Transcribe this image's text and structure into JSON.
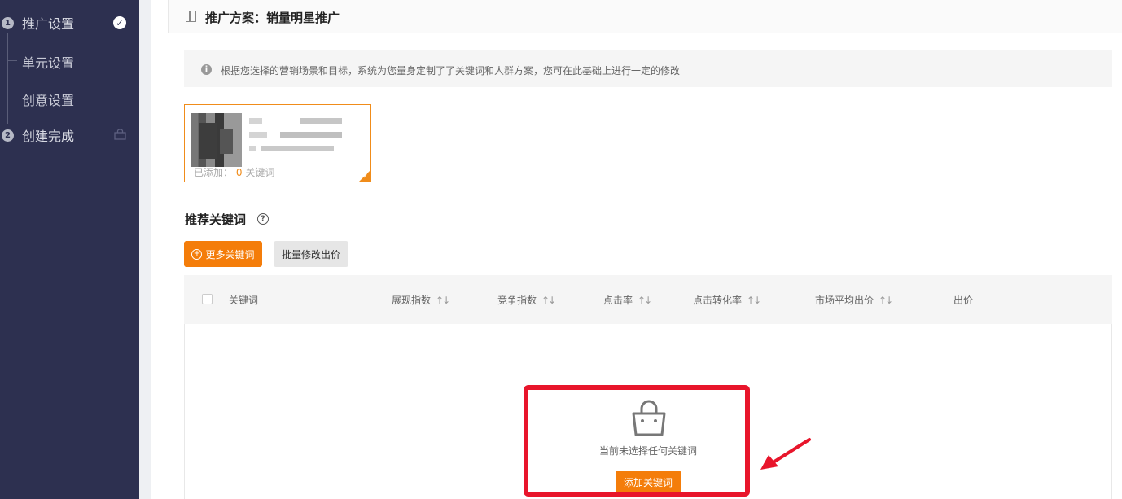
{
  "sidebar": {
    "steps": [
      {
        "num": "1",
        "label": "推广设置"
      },
      {
        "num": "2",
        "label": "创建完成"
      }
    ],
    "sub_items": [
      {
        "label": "单元设置"
      },
      {
        "label": "创意设置"
      }
    ],
    "check_mark": "✓"
  },
  "header": {
    "title": "推广方案：销量明星推广"
  },
  "info": {
    "icon": "i",
    "text": "根据您选择的营销场景和目标，系统为您量身定制了了关键词和人群方案，您可在此基础上进行一定的修改"
  },
  "plan_card": {
    "added_prefix": "已添加：",
    "added_count": "0",
    "added_suffix": "关键词"
  },
  "keywords_section": {
    "title": "推荐关键词",
    "help_icon": "?",
    "more_button": "更多关键词",
    "more_button_icon": "+",
    "batch_button": "批量修改出价"
  },
  "table": {
    "sort_glyph": "↑↓",
    "columns": [
      "关键词",
      "展现指数",
      "竞争指数",
      "点击率",
      "点击转化率",
      "市场平均出价",
      "出价"
    ]
  },
  "empty_state": {
    "text": "当前未选择任何关键词",
    "add_button": "添加关键词"
  },
  "colors": {
    "sidebar_bg": "#2d3050",
    "accent_orange": "#f47d0a",
    "highlight_red": "#e8152b"
  }
}
